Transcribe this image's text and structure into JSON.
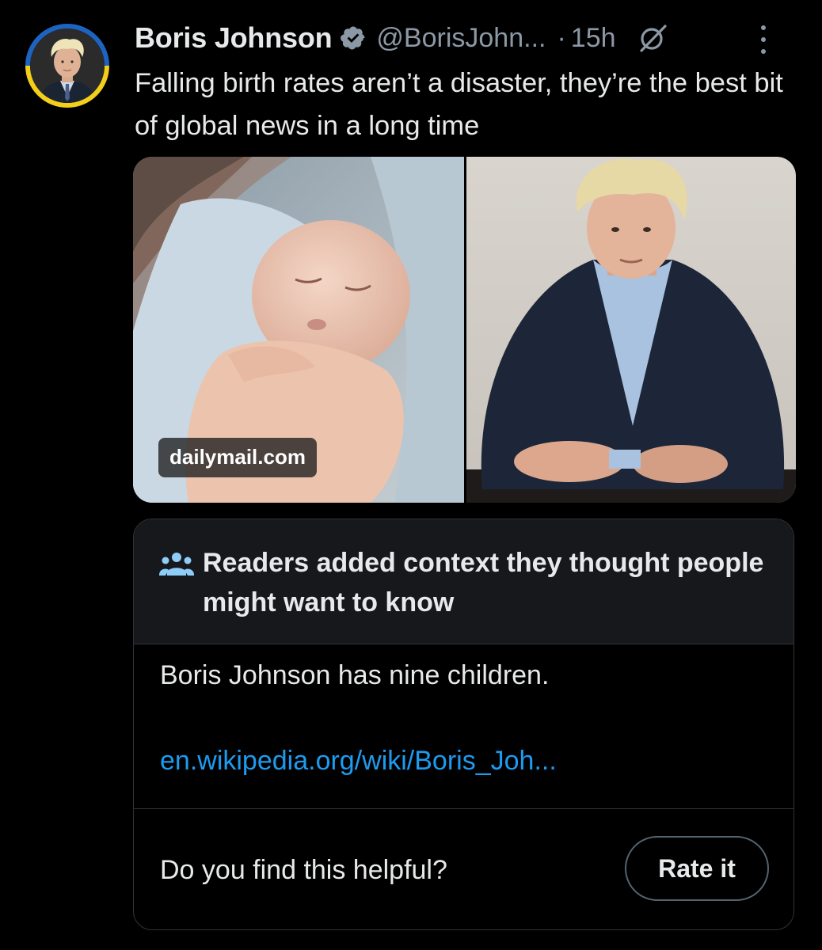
{
  "tweet": {
    "author": {
      "display_name": "Boris Johnson",
      "handle": "@BorisJohn...",
      "verified": true
    },
    "separator": "·",
    "time": "15h",
    "text": "Falling birth rates aren’t a disaster, they’re the best bit of global news in a long time",
    "media": {
      "source": "dailymail.com"
    }
  },
  "community_note": {
    "title": "Readers added context they thought people might want to know",
    "statement": "Boris Johnson has nine children.",
    "link": "en.wikipedia.org/wiki/Boris_Joh...",
    "question": "Do you find this helpful?",
    "rate_label": "Rate it"
  },
  "colors": {
    "background": "#000000",
    "text_primary": "#e7e9ea",
    "text_secondary": "#8b98a5",
    "link": "#1d9bf0",
    "border": "#2f3336",
    "note_header_bg": "#16181c",
    "avatar_ring_top": "#1d64c2",
    "avatar_ring_bottom": "#f3cf1a"
  },
  "icons": {
    "verified": "verified-badge-icon",
    "grok": "grok-icon",
    "more": "more-options-icon",
    "note": "people-icon"
  }
}
